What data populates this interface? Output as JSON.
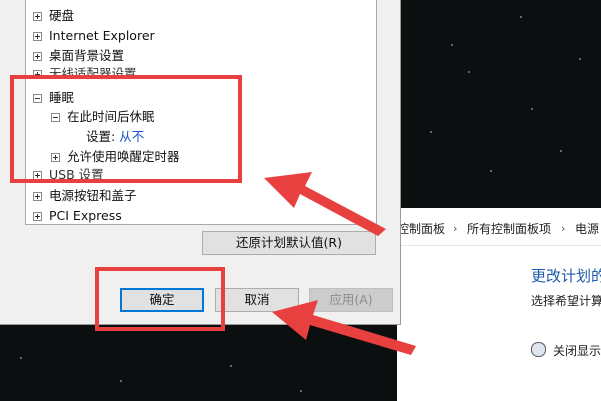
{
  "tree": {
    "items": [
      {
        "label": "硬盘",
        "toggle": "plus"
      },
      {
        "label": "Internet Explorer",
        "toggle": "plus"
      },
      {
        "label": "桌面背景设置",
        "toggle": "plus"
      },
      {
        "label": "无线适配器设置",
        "toggle": "plus"
      },
      {
        "label": "睡眠",
        "toggle": "minus"
      },
      {
        "label": "在此时间后休眠",
        "toggle": "minus"
      },
      {
        "label": "设置:",
        "value": "从不"
      },
      {
        "label": "允许使用唤醒定时器",
        "toggle": "plus"
      },
      {
        "label": "USB 设置",
        "toggle": "plus"
      },
      {
        "label": "电源按钮和盖子",
        "toggle": "plus"
      },
      {
        "label": "PCI Express",
        "toggle": "plus"
      }
    ]
  },
  "buttons": {
    "restore_defaults": "还原计划默认值(R)",
    "ok": "确定",
    "cancel": "取消",
    "apply": "应用(A)"
  },
  "control_panel": {
    "breadcrumb": [
      "控制面板",
      "所有控制面板项",
      "电源"
    ],
    "heading": "更改计划的",
    "subtitle": "选择希望计算",
    "row_label": "关闭显示"
  },
  "annotation_color": "#e8403f"
}
